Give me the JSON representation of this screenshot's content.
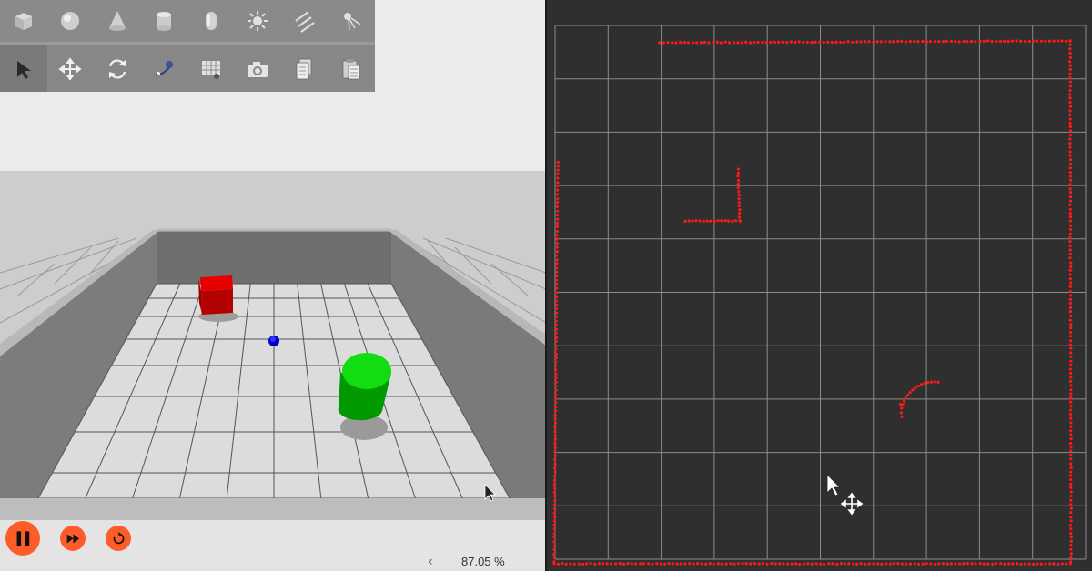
{
  "toolbar": {
    "row1": [
      {
        "name": "box-icon"
      },
      {
        "name": "sphere-icon"
      },
      {
        "name": "cone-icon"
      },
      {
        "name": "cylinder-icon"
      },
      {
        "name": "capsule-icon"
      },
      {
        "name": "sun-light-icon"
      },
      {
        "name": "directional-light-icon"
      },
      {
        "name": "spot-light-icon"
      }
    ],
    "row2": [
      {
        "name": "select-arrow-icon",
        "active": true
      },
      {
        "name": "translate-icon"
      },
      {
        "name": "rotate-icon"
      },
      {
        "name": "scale-icon"
      },
      {
        "name": "grid-snap-icon"
      },
      {
        "name": "screenshot-camera-icon"
      },
      {
        "name": "copy-icon"
      },
      {
        "name": "paste-icon"
      }
    ]
  },
  "playback": {
    "pause_icon": "pause-icon",
    "step_icon": "fast-forward-icon",
    "reset_icon": "reset-icon",
    "zoom_arrow": "‹",
    "zoom_level": "87.05 %"
  },
  "colors": {
    "accent": "#ff5c2a",
    "toolbar_bg": "#8a8a8a",
    "map_bg": "#2f2f2f",
    "map_grid": "#8c8c8c",
    "laser": "#ff1a1a",
    "red_box": "#cc0000",
    "green_cylinder": "#00cc00",
    "blue_robot": "#0000dd"
  },
  "scene": {
    "objects": [
      {
        "name": "red-box",
        "color": "#cc0000"
      },
      {
        "name": "green-cylinder",
        "color": "#00cc00"
      },
      {
        "name": "blue-robot",
        "color": "#0000dd"
      }
    ]
  },
  "map": {
    "grid_cells": 10
  }
}
